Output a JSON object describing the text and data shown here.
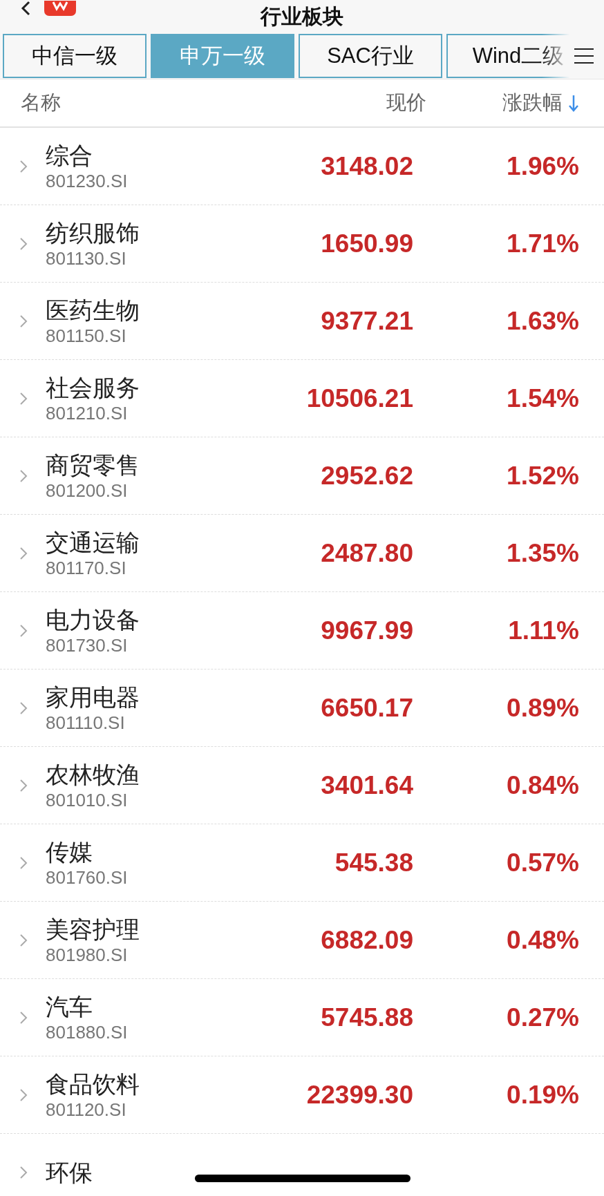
{
  "header": {
    "title": "行业板块"
  },
  "tabs": [
    {
      "label": "中信一级",
      "selected": false
    },
    {
      "label": "申万一级",
      "selected": true
    },
    {
      "label": "SAC行业",
      "selected": false
    },
    {
      "label": "Wind二级",
      "selected": false
    }
  ],
  "columns": {
    "name": "名称",
    "price": "现价",
    "change": "涨跌幅",
    "sort_descending": true
  },
  "rows": [
    {
      "name": "综合",
      "code": "801230.SI",
      "price": "3148.02",
      "change": "1.96%"
    },
    {
      "name": "纺织服饰",
      "code": "801130.SI",
      "price": "1650.99",
      "change": "1.71%"
    },
    {
      "name": "医药生物",
      "code": "801150.SI",
      "price": "9377.21",
      "change": "1.63%"
    },
    {
      "name": "社会服务",
      "code": "801210.SI",
      "price": "10506.21",
      "change": "1.54%"
    },
    {
      "name": "商贸零售",
      "code": "801200.SI",
      "price": "2952.62",
      "change": "1.52%"
    },
    {
      "name": "交通运输",
      "code": "801170.SI",
      "price": "2487.80",
      "change": "1.35%"
    },
    {
      "name": "电力设备",
      "code": "801730.SI",
      "price": "9967.99",
      "change": "1.11%"
    },
    {
      "name": "家用电器",
      "code": "801110.SI",
      "price": "6650.17",
      "change": "0.89%"
    },
    {
      "name": "农林牧渔",
      "code": "801010.SI",
      "price": "3401.64",
      "change": "0.84%"
    },
    {
      "name": "传媒",
      "code": "801760.SI",
      "price": "545.38",
      "change": "0.57%"
    },
    {
      "name": "美容护理",
      "code": "801980.SI",
      "price": "6882.09",
      "change": "0.48%"
    },
    {
      "name": "汽车",
      "code": "801880.SI",
      "price": "5745.88",
      "change": "0.27%"
    },
    {
      "name": "食品饮料",
      "code": "801120.SI",
      "price": "22399.30",
      "change": "0.19%"
    },
    {
      "name": "环保"
    }
  ]
}
